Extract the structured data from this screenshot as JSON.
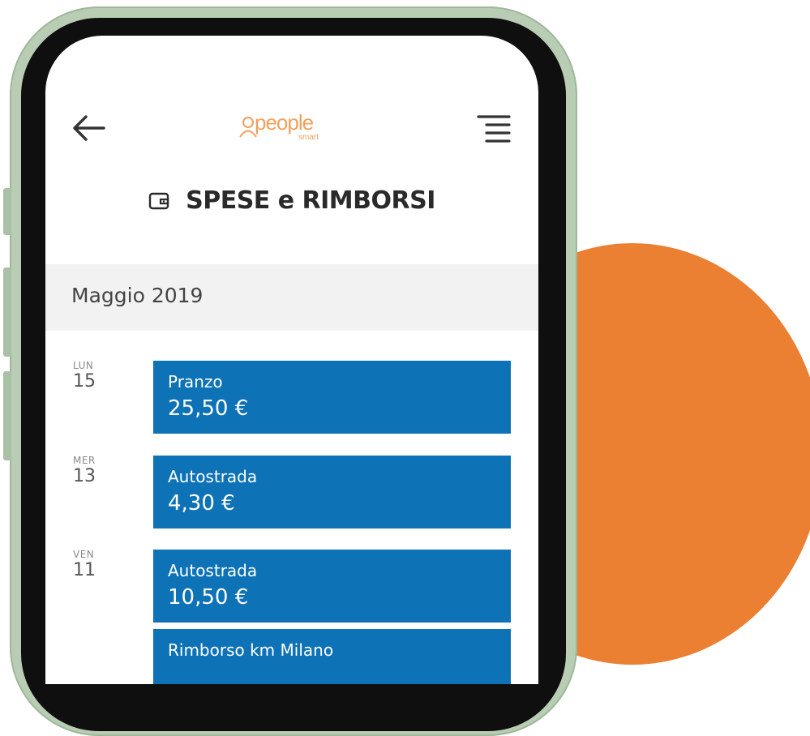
{
  "colors": {
    "accent_orange": "#eb7f32",
    "card_blue": "#0d72b6",
    "logo_orange": "#f0a15c",
    "phone_frame": "#b8cdb3"
  },
  "header": {
    "back_icon": "arrow-left-icon",
    "logo_text": "people",
    "logo_sub": "smart",
    "menu_icon": "hamburger-menu-icon"
  },
  "page": {
    "title": "SPESE e RIMBORSI",
    "title_icon": "wallet-icon"
  },
  "month": {
    "label": "Maggio 2019"
  },
  "entries": [
    {
      "day_name": "LUN",
      "day_num": "15",
      "items": [
        {
          "label": "Pranzo",
          "amount": "25,50 €"
        }
      ]
    },
    {
      "day_name": "MER",
      "day_num": "13",
      "items": [
        {
          "label": "Autostrada",
          "amount": "4,30 €"
        }
      ]
    },
    {
      "day_name": "VEN",
      "day_num": "11",
      "items": [
        {
          "label": "Autostrada",
          "amount": "10,50 €"
        },
        {
          "label": "Rimborso km Milano",
          "amount": ""
        }
      ]
    }
  ]
}
